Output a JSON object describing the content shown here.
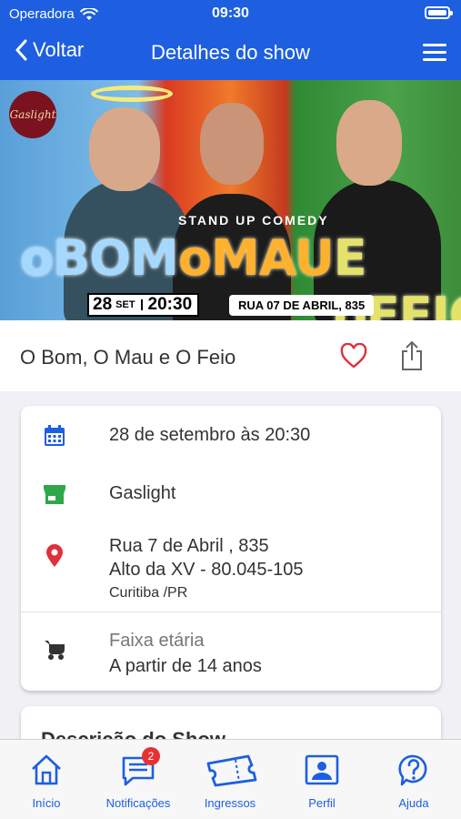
{
  "status_bar": {
    "carrier": "Operadora",
    "time": "09:30"
  },
  "header": {
    "back_label": "Voltar",
    "title": "Detalhes do show"
  },
  "banner": {
    "logo_text": "Gaslight",
    "subtitle": "STAND UP COMEDY",
    "title_parts": [
      "oBOM",
      "oMAU",
      "E oFEIO"
    ],
    "date_day": "28",
    "date_month": "SET",
    "date_time": "20:30",
    "address": "RUA 07 DE ABRIL, 835"
  },
  "show": {
    "name": "O Bom, O Mau e O Feio"
  },
  "details": {
    "datetime": "28 de setembro às 20:30",
    "venue": "Gaslight",
    "address_line1": "Rua 7 de Abril , 835",
    "address_line2": "Alto da XV - 80.045-105",
    "address_city": "Curitiba /PR",
    "age_label": "Faixa etária",
    "age_value": "A partir de 14 anos"
  },
  "description": {
    "heading": "Descrição do Show"
  },
  "tabbar": {
    "items": [
      {
        "label": "Início",
        "icon": "home-icon"
      },
      {
        "label": "Notificações",
        "icon": "chat-icon",
        "badge": "2"
      },
      {
        "label": "Ingressos",
        "icon": "ticket-icon"
      },
      {
        "label": "Perfil",
        "icon": "profile-icon"
      },
      {
        "label": "Ajuda",
        "icon": "help-icon"
      }
    ]
  },
  "colors": {
    "primary": "#1d5fe0",
    "calendar": "#1d5fe0",
    "store": "#2ea84a",
    "pin": "#e0303a",
    "heart": "#e0303a"
  }
}
